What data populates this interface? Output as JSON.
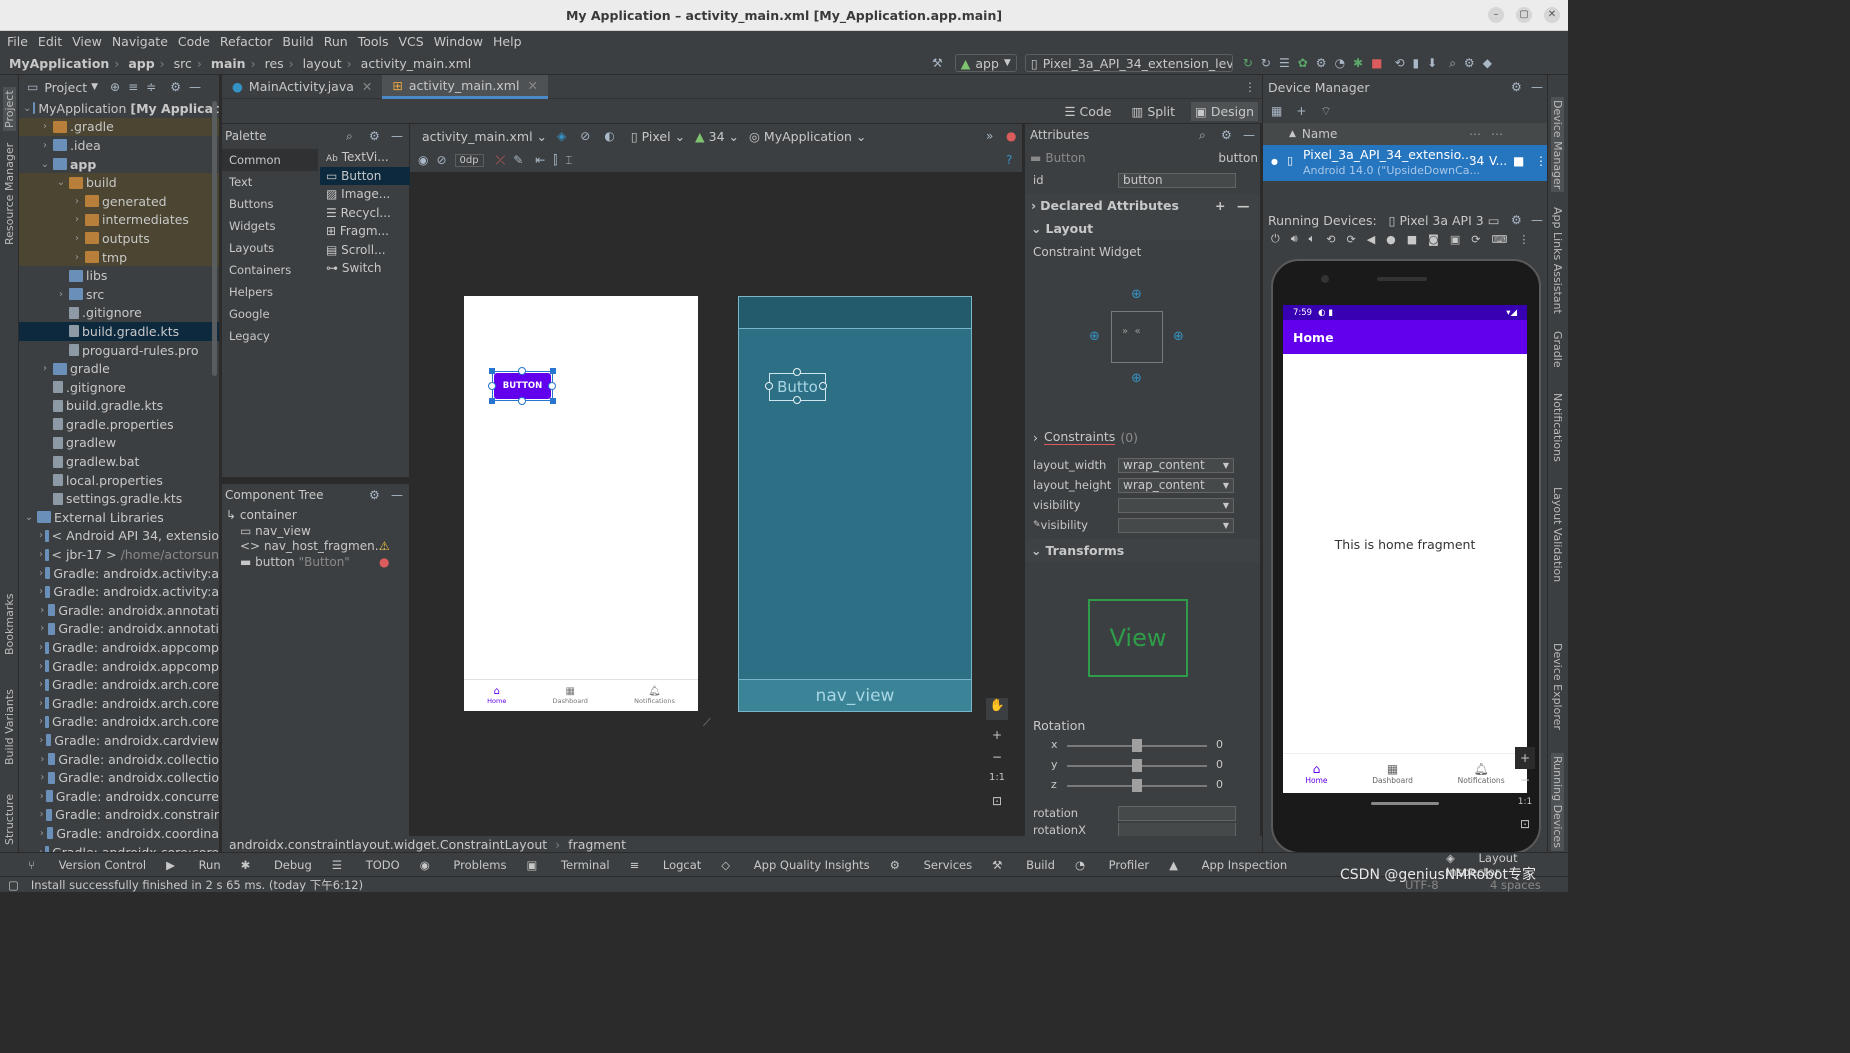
{
  "window": {
    "title": "My Application – activity_main.xml [My_Application.app.main]"
  },
  "menu": [
    "File",
    "Edit",
    "View",
    "Navigate",
    "Code",
    "Refactor",
    "Build",
    "Run",
    "Tools",
    "VCS",
    "Window",
    "Help"
  ],
  "nav": {
    "crumbs": [
      "MyApplication",
      "app",
      "src",
      "main",
      "res",
      "layout",
      "activity_main.xml"
    ],
    "config": "app",
    "device": "Pixel_3a_API_34_extension_lev"
  },
  "left_strip": [
    "Project",
    "Resource Manager",
    "Bookmarks",
    "Build Variants",
    "Structure"
  ],
  "project": {
    "title": "Project",
    "tree": [
      {
        "label": "MyApplication",
        "extra": "[My Applicat",
        "depth": 0,
        "chev": "⌄",
        "icon": "folder-b"
      },
      {
        "label": ".gradle",
        "depth": 1,
        "chev": "›",
        "icon": "folder",
        "hl": true
      },
      {
        "label": ".idea",
        "depth": 1,
        "chev": "›",
        "icon": "folder-b"
      },
      {
        "label": "app",
        "depth": 1,
        "chev": "⌄",
        "icon": "folder-b",
        "bold": true
      },
      {
        "label": "build",
        "depth": 2,
        "chev": "⌄",
        "icon": "folder",
        "hl": true
      },
      {
        "label": "generated",
        "depth": 3,
        "chev": "›",
        "icon": "folder",
        "hl": true
      },
      {
        "label": "intermediates",
        "depth": 3,
        "chev": "›",
        "icon": "folder",
        "hl": true
      },
      {
        "label": "outputs",
        "depth": 3,
        "chev": "›",
        "icon": "folder",
        "hl": true
      },
      {
        "label": "tmp",
        "depth": 3,
        "chev": "›",
        "icon": "folder",
        "hl": true
      },
      {
        "label": "libs",
        "depth": 2,
        "chev": "",
        "icon": "folder-b"
      },
      {
        "label": "src",
        "depth": 2,
        "chev": "›",
        "icon": "folder-b"
      },
      {
        "label": ".gitignore",
        "depth": 2,
        "chev": "",
        "icon": "fileic"
      },
      {
        "label": "build.gradle.kts",
        "depth": 2,
        "chev": "",
        "icon": "fileic",
        "sel": true
      },
      {
        "label": "proguard-rules.pro",
        "depth": 2,
        "chev": "",
        "icon": "fileic"
      },
      {
        "label": "gradle",
        "depth": 1,
        "chev": "›",
        "icon": "folder-b"
      },
      {
        "label": ".gitignore",
        "depth": 1,
        "chev": "",
        "icon": "fileic"
      },
      {
        "label": "build.gradle.kts",
        "depth": 1,
        "chev": "",
        "icon": "fileic"
      },
      {
        "label": "gradle.properties",
        "depth": 1,
        "chev": "",
        "icon": "fileic"
      },
      {
        "label": "gradlew",
        "depth": 1,
        "chev": "",
        "icon": "fileic"
      },
      {
        "label": "gradlew.bat",
        "depth": 1,
        "chev": "",
        "icon": "fileic"
      },
      {
        "label": "local.properties",
        "depth": 1,
        "chev": "",
        "icon": "fileic"
      },
      {
        "label": "settings.gradle.kts",
        "depth": 1,
        "chev": "",
        "icon": "fileic"
      },
      {
        "label": "External Libraries",
        "depth": 0,
        "chev": "⌄",
        "icon": "folder-b"
      },
      {
        "label": "< Android API 34, extensio",
        "depth": 1,
        "chev": "›",
        "icon": "folder-b"
      },
      {
        "label": "< jbr-17 >",
        "extra": "/home/actorsun",
        "depth": 1,
        "chev": "›",
        "icon": "folder-b"
      },
      {
        "label": "Gradle: androidx.activity:a",
        "depth": 1,
        "chev": "›",
        "icon": "folder-b"
      },
      {
        "label": "Gradle: androidx.activity:a",
        "depth": 1,
        "chev": "›",
        "icon": "folder-b"
      },
      {
        "label": "Gradle: androidx.annotati",
        "depth": 1,
        "chev": "›",
        "icon": "folder-b"
      },
      {
        "label": "Gradle: androidx.annotati",
        "depth": 1,
        "chev": "›",
        "icon": "folder-b"
      },
      {
        "label": "Gradle: androidx.appcomp",
        "depth": 1,
        "chev": "›",
        "icon": "folder-b"
      },
      {
        "label": "Gradle: androidx.appcomp",
        "depth": 1,
        "chev": "›",
        "icon": "folder-b"
      },
      {
        "label": "Gradle: androidx.arch.core",
        "depth": 1,
        "chev": "›",
        "icon": "folder-b"
      },
      {
        "label": "Gradle: androidx.arch.core",
        "depth": 1,
        "chev": "›",
        "icon": "folder-b"
      },
      {
        "label": "Gradle: androidx.arch.core",
        "depth": 1,
        "chev": "›",
        "icon": "folder-b"
      },
      {
        "label": "Gradle: androidx.cardview",
        "depth": 1,
        "chev": "›",
        "icon": "folder-b"
      },
      {
        "label": "Gradle: androidx.collectio",
        "depth": 1,
        "chev": "›",
        "icon": "folder-b"
      },
      {
        "label": "Gradle: androidx.collectio",
        "depth": 1,
        "chev": "›",
        "icon": "folder-b"
      },
      {
        "label": "Gradle: androidx.concurre",
        "depth": 1,
        "chev": "›",
        "icon": "folder-b"
      },
      {
        "label": "Gradle: androidx.constrair",
        "depth": 1,
        "chev": "›",
        "icon": "folder-b"
      },
      {
        "label": "Gradle: androidx.coordina",
        "depth": 1,
        "chev": "›",
        "icon": "folder-b"
      },
      {
        "label": "Gradle: androidx.core:core",
        "depth": 1,
        "chev": "›",
        "icon": "folder-b"
      }
    ]
  },
  "tabs": [
    {
      "label": "MainActivity.java",
      "active": false
    },
    {
      "label": "activity_main.xml",
      "active": true
    }
  ],
  "view_modes": [
    "Code",
    "Split",
    "Design"
  ],
  "palette": {
    "title": "Palette",
    "categories": [
      "Common",
      "Text",
      "Buttons",
      "Widgets",
      "Layouts",
      "Containers",
      "Helpers",
      "Google",
      "Legacy"
    ],
    "items": [
      "TextVi...",
      "Button",
      "Image...",
      "Recycl...",
      "Fragm...",
      "Scroll...",
      "Switch"
    ]
  },
  "ctree": {
    "title": "Component Tree",
    "items": [
      {
        "label": "container",
        "depth": 0
      },
      {
        "label": "nav_view",
        "depth": 1
      },
      {
        "label": "nav_host_fragmen...",
        "depth": 1,
        "warn": true
      },
      {
        "label": "button",
        "hint": "\"Button\"",
        "depth": 1,
        "err": true
      }
    ]
  },
  "canvas": {
    "file": "activity_main.xml",
    "device": "Pixel",
    "api": "34",
    "theme": "MyApplication",
    "dp": "0dp",
    "button_text": "BUTTON",
    "blue_button": "Butto",
    "nav_view": "nav_view",
    "nav": [
      "Home",
      "Dashboard",
      "Notifications"
    ],
    "zoom": "1:1"
  },
  "breadcrumbs": [
    "androidx.constraintlayout.widget.ConstraintLayout",
    "fragment"
  ],
  "attributes": {
    "title": "Attributes",
    "widget": "Button",
    "widget_id": "button",
    "id_label": "id",
    "id_value": "button",
    "declared": "Declared Attributes",
    "layout": "Layout",
    "constraint_widget": "Constraint Widget",
    "constraints": "Constraints",
    "constraints_count": "(0)",
    "rows": [
      {
        "label": "layout_width",
        "value": "wrap_content"
      },
      {
        "label": "layout_height",
        "value": "wrap_content"
      },
      {
        "label": "visibility",
        "value": ""
      },
      {
        "label": "visibility",
        "value": ""
      }
    ],
    "transforms": "Transforms",
    "view_label": "View",
    "rotation": "Rotation",
    "axes": [
      {
        "label": "x",
        "value": "0",
        "level": 0.5
      },
      {
        "label": "y",
        "value": "0",
        "level": 0.5
      },
      {
        "label": "z",
        "value": "0",
        "level": 0.5
      }
    ],
    "rotation_label": "rotation",
    "rotationx_label": "rotationX"
  },
  "device_manager": {
    "title": "Device Manager",
    "col": "Name",
    "device": "Pixel_3a_API_34_extensio...",
    "api": "34",
    "api_extra": "V...",
    "device_sub": "Android 14.0 (\"UpsideDownCa...",
    "running": "Running Devices:",
    "running_tab": "Pixel 3a API 3"
  },
  "phone": {
    "time": "7:59",
    "title": "Home",
    "body": "This is home fragment",
    "nav": [
      "Home",
      "Dashboard",
      "Notifications"
    ]
  },
  "right_strip": [
    "Device Manager",
    "App Links Assistant",
    "Gradle",
    "Notifications",
    "Layout Validation",
    "Device Explorer",
    "Running Devices"
  ],
  "bottom_tools": [
    "Version Control",
    "Run",
    "Debug",
    "TODO",
    "Problems",
    "Terminal",
    "Logcat",
    "App Quality Insights",
    "Services",
    "Build",
    "Profiler",
    "App Inspection"
  ],
  "layout_inspector": "Layout Inspector",
  "status": {
    "message": "Install successfully finished in 2 s 65 ms. (today 下午6:12)",
    "encoding": "UTF-8",
    "indent": "4 spaces",
    "watermark": "CSDN @geniusNMRobot专家"
  },
  "colors": {
    "accent": "#4a88c7",
    "purple": "#6200ee",
    "blueprint": "#2d6f84",
    "selection": "#0d293e",
    "device_row": "#2675bf"
  }
}
